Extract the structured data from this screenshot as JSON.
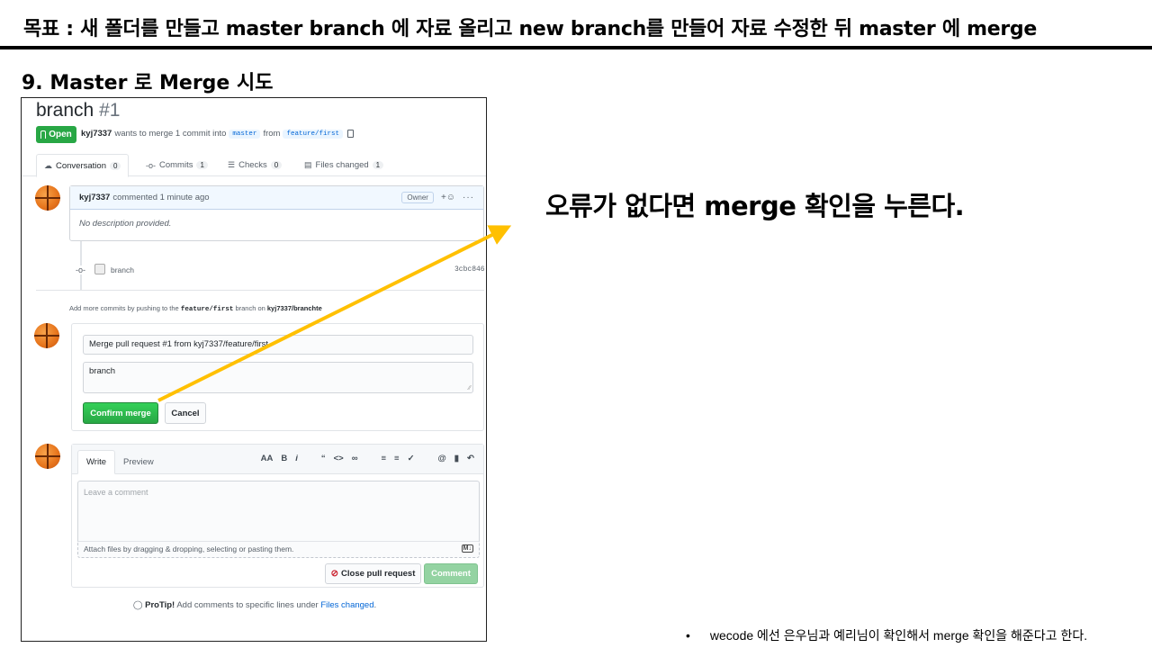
{
  "slide": {
    "title": "목표 : 새 폴더를 만들고 master branch 에 자료 올리고 new branch를 만들어 자료 수정한 뒤 master 에 merge",
    "section": "9. Master 로 Merge 시도",
    "callout": "오류가 없다면 merge 확인을 누른다.",
    "footnote_bullet": "•",
    "footnote": "wecode 에선 은우님과 예리님이 확인해서 merge 확인을 해준다고 한다.",
    "arrow_color": "#ffc000"
  },
  "pr": {
    "title": "branch",
    "number": "#1",
    "state": "Open",
    "author": "kyj7337",
    "meta_text": "wants to merge 1 commit into",
    "base_branch": "master",
    "from_text": "from",
    "head_branch": "feature/first"
  },
  "tabs": [
    {
      "label": "Conversation",
      "count": "0",
      "icon": "comment-discussion-icon"
    },
    {
      "label": "Commits",
      "count": "1",
      "icon": "git-commit-icon"
    },
    {
      "label": "Checks",
      "count": "0",
      "icon": "checklist-icon"
    },
    {
      "label": "Files changed",
      "count": "1",
      "icon": "file-diff-icon"
    }
  ],
  "comment": {
    "author": "kyj7337",
    "time": "commented 1 minute ago",
    "badge": "Owner",
    "body": "No description provided."
  },
  "commit": {
    "message": "branch",
    "sha": "3cbc846"
  },
  "push_note": {
    "prefix": "Add more commits by pushing to the",
    "branch": "feature/first",
    "middle": "branch on",
    "repo": "kyj7337/branchte"
  },
  "merge_form": {
    "title_value": "Merge pull request #1 from kyj7337/feature/first",
    "body_value": "branch",
    "confirm_label": "Confirm merge",
    "cancel_label": "Cancel"
  },
  "new_comment": {
    "write_tab": "Write",
    "preview_tab": "Preview",
    "placeholder": "Leave a comment",
    "attach_hint": "Attach files by dragging & dropping, selecting or pasting them.",
    "close_label": "Close pull request",
    "comment_label": "Comment"
  },
  "protip": {
    "lead": "ProTip!",
    "text": "Add comments to specific lines under",
    "link": "Files changed"
  },
  "colors": {
    "green": "#28a745",
    "link_blue": "#0366d6"
  }
}
